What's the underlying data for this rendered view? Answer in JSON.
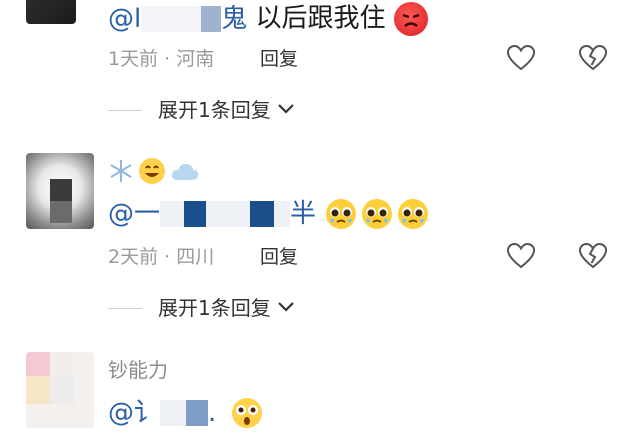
{
  "comments": [
    {
      "mention_prefix": "@l",
      "mention_tail": "鬼",
      "text": "以后跟我住",
      "time": "1天前",
      "location": "河南",
      "reply_label": "回复",
      "expand_label": "展开1条回复"
    },
    {
      "mention_prefix": "@一",
      "mention_tail": "半",
      "time": "2天前",
      "location": "四川",
      "reply_label": "回复",
      "expand_label": "展开1条回复"
    },
    {
      "username": "钞能力",
      "mention_prefix": "@讠",
      "mention_tail": "."
    }
  ],
  "meta_separator": "·",
  "icons": [
    "like-heart-icon",
    "dislike-broken-heart-icon",
    "chevron-down-icon",
    "angry-emoji-icon",
    "pleading-emoji-icon",
    "grin-emoji-icon",
    "snowflake-icon",
    "cloud-icon",
    "surprised-emoji-icon"
  ],
  "colors": {
    "mention": "#2a5fa8",
    "meta": "#9a9a9a",
    "text": "#1a1a1a"
  }
}
